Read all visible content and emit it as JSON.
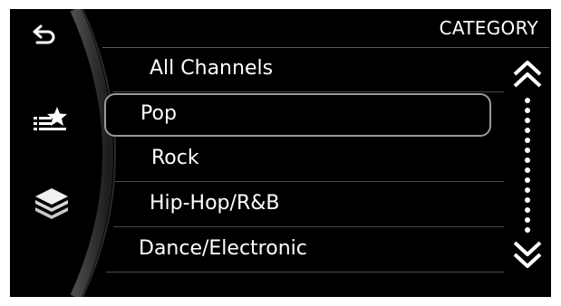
{
  "header": {
    "title": "CATEGORY"
  },
  "left_rail": {
    "back": "back-arrow-icon",
    "favorites": "favorites-star-icon",
    "layers": "layers-icon"
  },
  "list": {
    "items": [
      {
        "label": "All Channels",
        "selected": false
      },
      {
        "label": "Pop",
        "selected": true
      },
      {
        "label": "Rock",
        "selected": false
      },
      {
        "label": "Hip-Hop/R&B",
        "selected": false
      },
      {
        "label": "Dance/Electronic",
        "selected": false
      }
    ]
  },
  "scrollbar": {
    "up": "double-chevron-up-icon",
    "down": "double-chevron-down-icon"
  },
  "colors": {
    "background": "#000000",
    "text": "#ffffff",
    "selection_border": "#9a9a9a",
    "separator": "#4a4a4a"
  }
}
